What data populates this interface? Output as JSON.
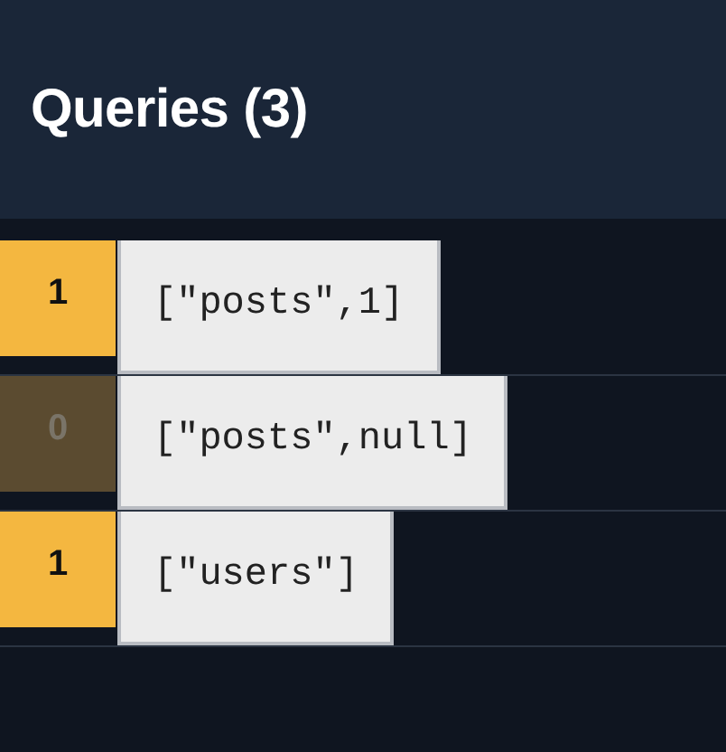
{
  "title": "Queries (3)",
  "queries": [
    {
      "observers": "1",
      "inactive": false,
      "key": "[\"posts\",1]"
    },
    {
      "observers": "0",
      "inactive": true,
      "key": "[\"posts\",null]"
    },
    {
      "observers": "1",
      "inactive": false,
      "key": "[\"users\"]"
    }
  ]
}
